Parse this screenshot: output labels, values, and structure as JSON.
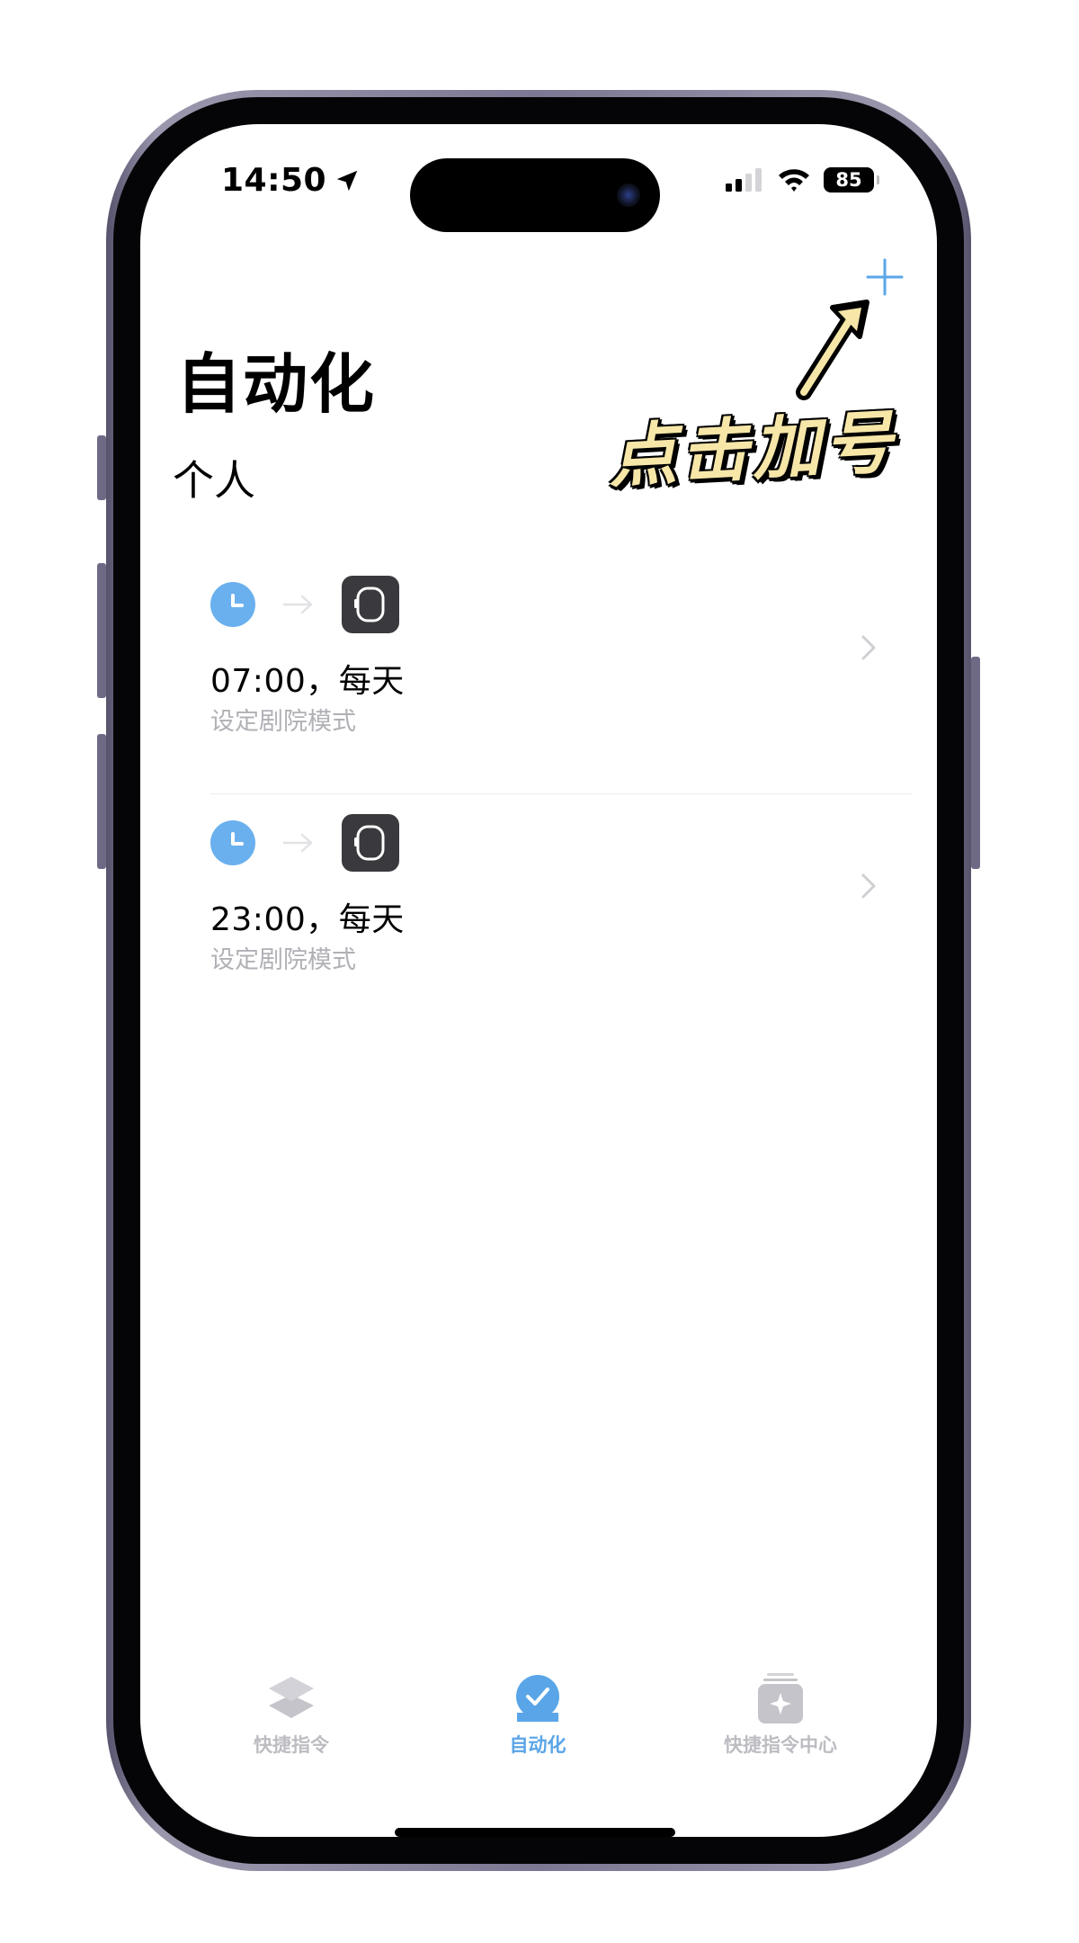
{
  "status_bar": {
    "time": "14:50",
    "battery": "85"
  },
  "header": {
    "title": "自动化",
    "section": "个人",
    "add_icon": "plus-icon"
  },
  "annotation": {
    "text": "点击加号"
  },
  "automations": [
    {
      "title": "07:00，每天",
      "subtitle": "设定剧院模式",
      "trigger_icon": "clock-icon",
      "action_icon": "watch-icon"
    },
    {
      "title": "23:00，每天",
      "subtitle": "设定剧院模式",
      "trigger_icon": "clock-icon",
      "action_icon": "watch-icon"
    }
  ],
  "tabbar": {
    "tabs": [
      {
        "label": "快捷指令",
        "icon": "layers-icon",
        "active": false
      },
      {
        "label": "自动化",
        "icon": "checkmark-circle-icon",
        "active": true
      },
      {
        "label": "快捷指令中心",
        "icon": "gallery-sparkle-icon",
        "active": false
      }
    ]
  },
  "colors": {
    "accent": "#5aa5e8",
    "clock": "#6ab0ee",
    "inactive_tab": "#bcbcc2",
    "subtitle": "#b0b0b6",
    "annotation_fill": "#f6e6a8"
  }
}
